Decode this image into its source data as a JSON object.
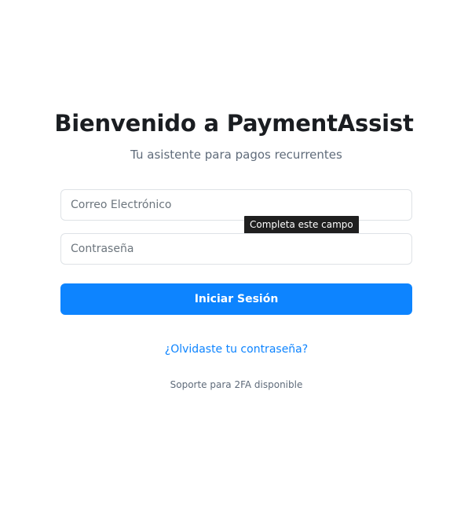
{
  "header": {
    "title": "Bienvenido a PaymentAssist",
    "subtitle": "Tu asistente para pagos recurrentes"
  },
  "form": {
    "email_placeholder": "Correo Electrónico",
    "email_value": "",
    "password_placeholder": "Contraseña",
    "password_value": "",
    "validation_tooltip": "Completa este campo",
    "submit_label": "Iniciar Sesión"
  },
  "links": {
    "forgot_password": "¿Olvidaste tu contraseña?"
  },
  "footer": {
    "support_note": "Soporte para 2FA disponible"
  },
  "colors": {
    "primary": "#0d84ff",
    "title_text": "#1a1d21",
    "muted_text": "#5f6b7a",
    "input_border": "#dee2e6",
    "tooltip_bg": "#1f1f1f"
  }
}
